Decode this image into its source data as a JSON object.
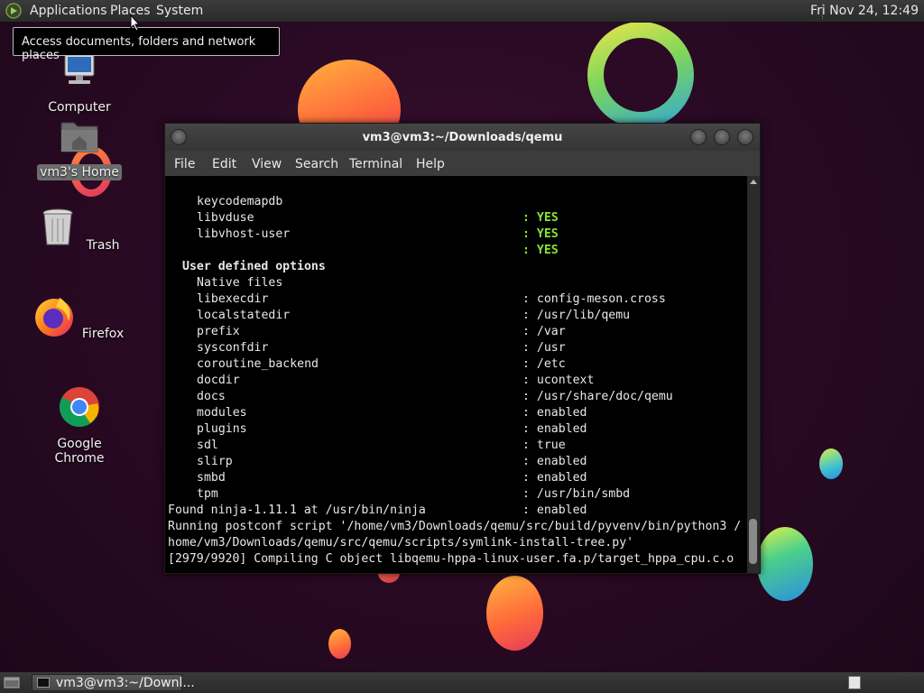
{
  "top_panel": {
    "menus": [
      "Applications",
      "Places",
      "System"
    ],
    "clock": "Fri Nov 24, 12:49"
  },
  "tooltip": "Access documents, folders and network places",
  "desktop_icons": [
    {
      "label": "Computer",
      "icon": "computer-icon"
    },
    {
      "label": "vm3's Home",
      "icon": "home-folder-icon",
      "selected": true
    },
    {
      "label": "Trash",
      "icon": "trash-icon"
    },
    {
      "label": "Firefox",
      "icon": "firefox-icon"
    },
    {
      "label": "Google Chrome",
      "icon": "chrome-icon"
    }
  ],
  "terminal": {
    "title": "vm3@vm3:~/Downloads/qemu",
    "menus": [
      "File",
      "Edit",
      "View",
      "Search",
      "Terminal",
      "Help"
    ],
    "lines": {
      "l0": {
        "key": "keycodemapdb",
        "value": ": YES"
      },
      "l1": {
        "key": "libvduse",
        "value": ": YES"
      },
      "l2": {
        "key": "libvhost-user",
        "value": ": YES"
      },
      "header": "User defined options",
      "l3": {
        "key": "Native files",
        "value": ": config-meson.cross"
      },
      "l4": {
        "key": "libexecdir",
        "value": ": /usr/lib/qemu"
      },
      "l5": {
        "key": "localstatedir",
        "value": ": /var"
      },
      "l6": {
        "key": "prefix",
        "value": ": /usr"
      },
      "l7": {
        "key": "sysconfdir",
        "value": ": /etc"
      },
      "l8": {
        "key": "coroutine_backend",
        "value": ": ucontext"
      },
      "l9": {
        "key": "docdir",
        "value": ": /usr/share/doc/qemu"
      },
      "l10": {
        "key": "docs",
        "value": ": enabled"
      },
      "l11": {
        "key": "modules",
        "value": ": enabled"
      },
      "l12": {
        "key": "plugins",
        "value": ": true"
      },
      "l13": {
        "key": "sdl",
        "value": ": enabled"
      },
      "l14": {
        "key": "slirp",
        "value": ": enabled"
      },
      "l15": {
        "key": "smbd",
        "value": ": /usr/bin/smbd"
      },
      "l16": {
        "key": "tpm",
        "value": ": enabled"
      },
      "out1": "Found ninja-1.11.1 at /usr/bin/ninja",
      "out2": "Running postconf script '/home/vm3/Downloads/qemu/src/build/pyvenv/bin/python3 /",
      "out3": "home/vm3/Downloads/qemu/src/qemu/scripts/symlink-install-tree.py'",
      "out4": "[2979/9920] Compiling C object libqemu-hppa-linux-user.fa.p/target_hppa_cpu.c.o"
    }
  },
  "taskbar": {
    "window_button": "vm3@vm3:~/Downl..."
  },
  "colors": {
    "yes_green": "#8ae234",
    "terminal_bg": "#000000"
  }
}
